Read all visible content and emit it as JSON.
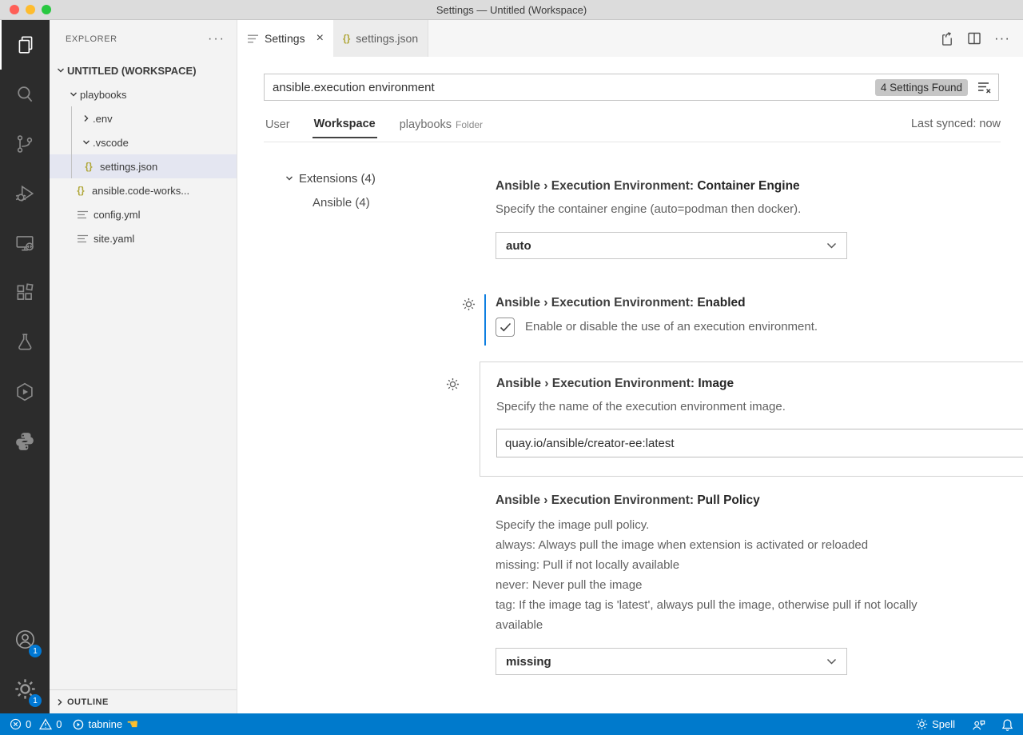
{
  "window": {
    "title": "Settings — Untitled (Workspace)"
  },
  "icons": {
    "more": "···",
    "close": "×",
    "braces": "{}"
  },
  "activity_bar": {
    "account_badge": "1",
    "settings_badge": "1"
  },
  "sidebar": {
    "header": "EXPLORER",
    "root": "UNTITLED (WORKSPACE)",
    "tree": [
      {
        "label": "playbooks"
      },
      {
        "label": ".env"
      },
      {
        "label": ".vscode"
      },
      {
        "label": "settings.json"
      },
      {
        "label": "ansible.code-works..."
      },
      {
        "label": "config.yml"
      },
      {
        "label": "site.yaml"
      }
    ],
    "outline": "OUTLINE"
  },
  "tabs": {
    "settings": "Settings",
    "settings_json": "settings.json"
  },
  "settings_editor": {
    "search_value": "ansible.execution environment",
    "results_badge": "4 Settings Found",
    "scopes": {
      "user": "User",
      "workspace": "Workspace",
      "folder": "playbooks",
      "folder_suffix": "Folder"
    },
    "last_synced": "Last synced: now",
    "toc": {
      "extensions": "Extensions (4)",
      "ansible": "Ansible (4)"
    },
    "settings": [
      {
        "category": "Ansible › Execution Environment: ",
        "name": "Container Engine",
        "description": "Specify the container engine (auto=podman then docker).",
        "value": "auto"
      },
      {
        "category": "Ansible › Execution Environment: ",
        "name": "Enabled",
        "description": "Enable or disable the use of an execution environment.",
        "checked": true
      },
      {
        "category": "Ansible › Execution Environment: ",
        "name": "Image",
        "description": "Specify the name of the execution environment image.",
        "value": "quay.io/ansible/creator-ee:latest"
      },
      {
        "category": "Ansible › Execution Environment: ",
        "name": "Pull Policy",
        "description_lines": [
          "Specify the image pull policy.",
          "always: Always pull the image when extension is activated or reloaded",
          "missing: Pull if not locally available",
          "never: Never pull the image",
          "tag: If the image tag is 'latest', always pull the image, otherwise pull if not locally available"
        ],
        "value": "missing"
      }
    ]
  },
  "status_bar": {
    "errors": "0",
    "warnings": "0",
    "tabnine": "tabnine",
    "pointer_hand": "☚",
    "spell": "Spell"
  },
  "colors": {
    "accent_modified": "#0e7fe1",
    "status_bar": "#007acc",
    "list_selection": "#e4e6f1",
    "badge_bg": "#c6c6c6",
    "activity_bar_bg": "#2c2c2c",
    "json_icon": "#b0a73a",
    "titlebar_bg": "#dcdcdc"
  }
}
